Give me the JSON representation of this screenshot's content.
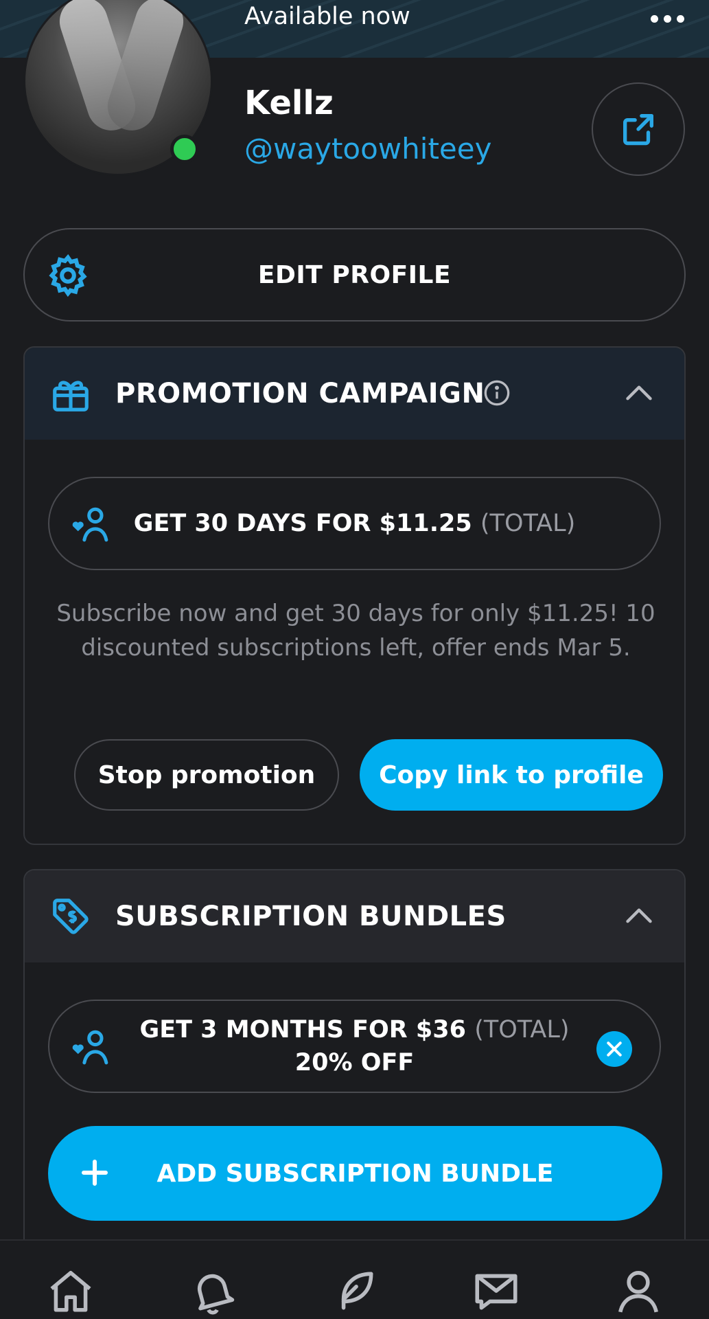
{
  "header": {
    "status_text": "Available now",
    "more_icon": "more-horizontal-icon"
  },
  "profile": {
    "name": "Kellz",
    "handle": "@waytoowhiteey",
    "online": true,
    "share_icon": "share-icon"
  },
  "edit_profile": {
    "label": "EDIT PROFILE",
    "icon": "gear-icon"
  },
  "promotion_campaign": {
    "title": "PROMOTION CAMPAIGN",
    "icon": "gift-icon",
    "expanded": true,
    "offer_main": "GET 30 DAYS FOR $11.25",
    "offer_suffix": "(TOTAL)",
    "description": "Subscribe now and get 30 days for only $11.25! 10 discounted subscriptions left, offer ends Mar 5.",
    "stop_label": "Stop promotion",
    "copy_label": "Copy link to profile"
  },
  "subscription_bundles": {
    "title": "SUBSCRIPTION BUNDLES",
    "icon": "price-tag-icon",
    "expanded": true,
    "bundle_main": "GET 3 MONTHS FOR $36",
    "bundle_suffix": "(TOTAL)",
    "bundle_discount": "20% OFF",
    "add_label": "ADD SUBSCRIPTION BUNDLE"
  },
  "bottom_nav": [
    "home-icon",
    "bell-icon",
    "feather-icon",
    "message-icon",
    "user-icon"
  ],
  "colors": {
    "accent": "#00aeef",
    "handle": "#2aa8e6",
    "online": "#2fcb54",
    "background": "#1b1c1f"
  }
}
